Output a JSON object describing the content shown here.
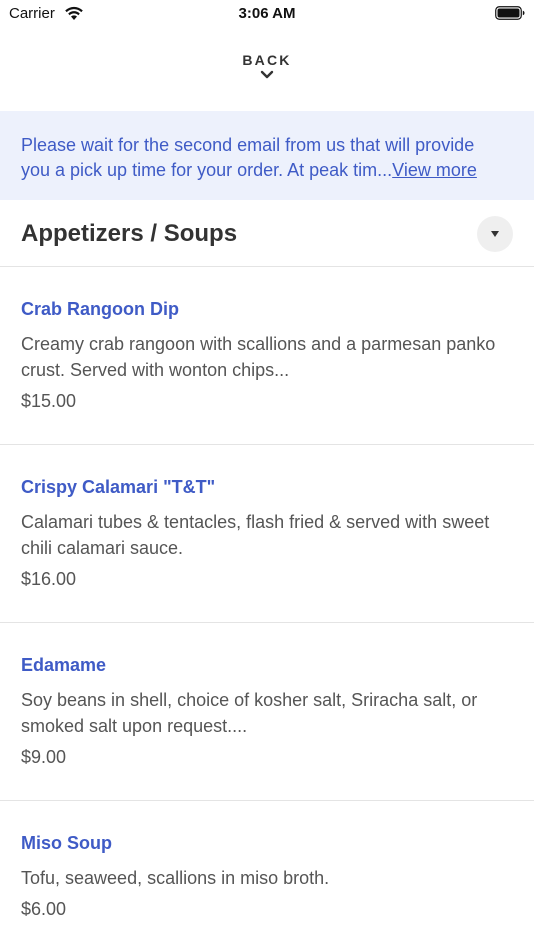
{
  "status_bar": {
    "carrier": "Carrier",
    "time": "3:06 AM",
    "icons": [
      "wifi-icon",
      "battery-icon"
    ]
  },
  "nav": {
    "back_label": "BACK",
    "back_icon": "chevron-down-icon"
  },
  "notice": {
    "line1": "Please wait for the second email from us that will provide",
    "line2": "you a pick up time for your order. At peak tim...",
    "view_more": "View more"
  },
  "section": {
    "title": "Appetizers / Soups",
    "toggle_icon": "caret-down-icon"
  },
  "items": [
    {
      "name": "Crab Rangoon Dip",
      "description": "Creamy crab rangoon with scallions and a parmesan panko crust. Served with wonton chips...",
      "price": "$15.00"
    },
    {
      "name": "Crispy Calamari \"T&T\"",
      "description": "Calamari tubes & tentacles, flash fried & served with sweet chili calamari sauce.",
      "price": "$16.00"
    },
    {
      "name": "Edamame",
      "description": "Soy beans in shell, choice of kosher salt, Sriracha salt, or smoked salt upon request....",
      "price": "$9.00"
    },
    {
      "name": "Miso Soup",
      "description": "Tofu, seaweed, scallions in miso broth.",
      "price": "$6.00"
    }
  ],
  "colors": {
    "accent": "#3f5bc6",
    "notice_bg": "#edf1fc",
    "divider": "#e4e4e4"
  }
}
